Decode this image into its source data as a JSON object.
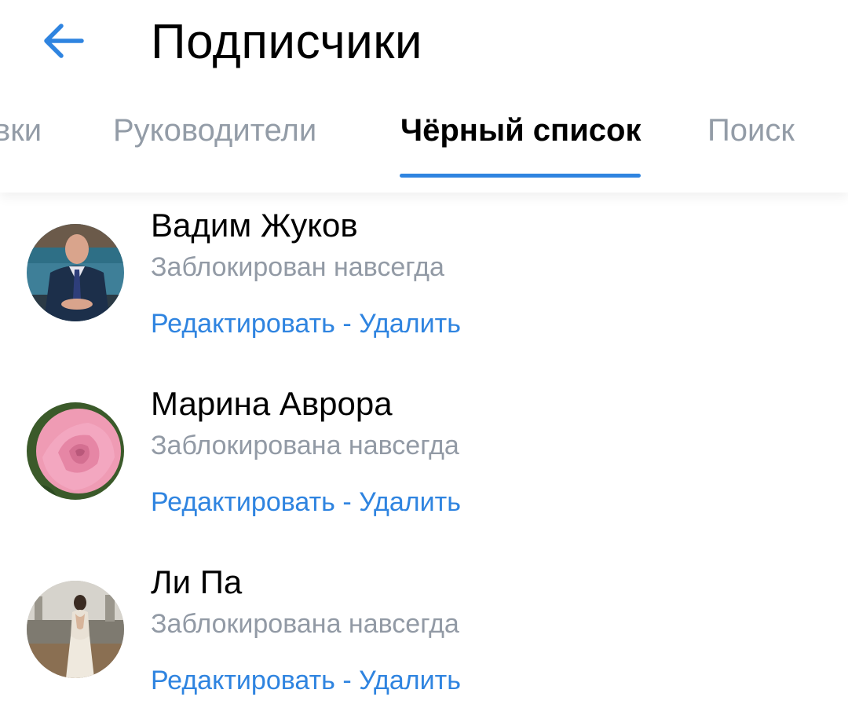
{
  "header": {
    "back_icon": "arrow-left-icon",
    "title": "Подписчики"
  },
  "tabs": [
    {
      "label": "вки",
      "active": false
    },
    {
      "label": "Руководители",
      "active": false
    },
    {
      "label": "Чёрный список",
      "active": true
    },
    {
      "label": "Поиск",
      "active": false
    }
  ],
  "colors": {
    "accent": "#2f84e0",
    "muted_text": "#929aa5",
    "primary_text": "#000000"
  },
  "blacklist": [
    {
      "name": "Вадим Жуков",
      "status": "Заблокирован навсегда",
      "edit_label": "Редактировать",
      "separator": " - ",
      "delete_label": "Удалить"
    },
    {
      "name": "Марина Аврора",
      "status": "Заблокирована навсегда",
      "edit_label": "Редактировать",
      "separator": " - ",
      "delete_label": "Удалить"
    },
    {
      "name": "Ли Па",
      "status": "Заблокирована навсегда",
      "edit_label": "Редактировать",
      "separator": " - ",
      "delete_label": "Удалить"
    }
  ]
}
